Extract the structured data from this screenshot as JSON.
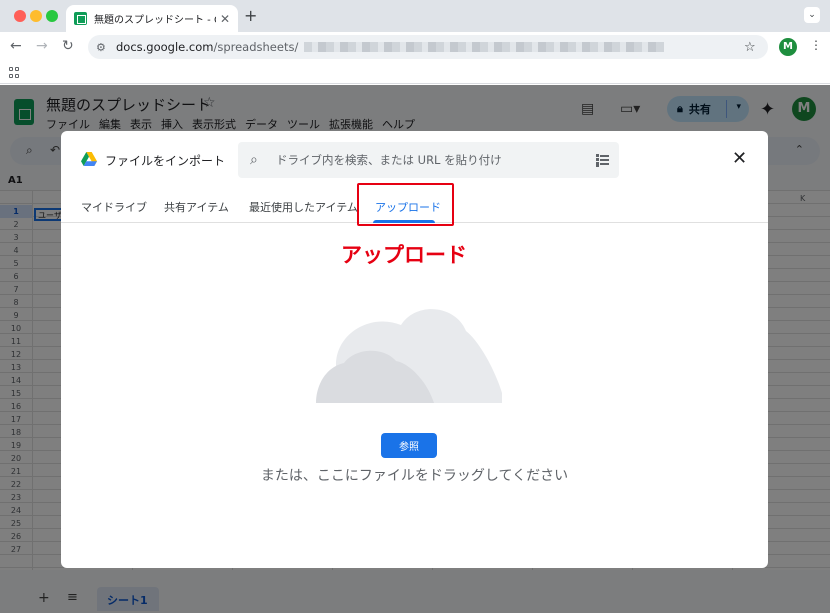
{
  "browser": {
    "tab_title": "無題のスプレッドシート - Google",
    "url_host": "docs.google.com",
    "url_path": "/spreadsheets/",
    "profile_initial": "M"
  },
  "sheets": {
    "doc_title": "無題のスプレッドシート",
    "menu": [
      "ファイル",
      "編集",
      "表示",
      "挿入",
      "表示形式",
      "データ",
      "ツール",
      "拡張機能",
      "ヘルプ"
    ],
    "share_label": "共有",
    "avatar_initial": "M",
    "namebox": "A1",
    "cell_a1": "ユーザ",
    "column_k": "K",
    "row_numbers": [
      "1",
      "2",
      "3",
      "4",
      "5",
      "6",
      "7",
      "8",
      "9",
      "10",
      "11",
      "12",
      "13",
      "14",
      "15",
      "16",
      "17",
      "18",
      "19",
      "20",
      "21",
      "22",
      "23",
      "24",
      "25",
      "26",
      "27"
    ],
    "sheet_tab": "シート1"
  },
  "dialog": {
    "title": "ファイルをインポート",
    "search_placeholder": "ドライブ内を検索、または URL を貼り付け",
    "tabs": [
      {
        "label": "マイドライブ"
      },
      {
        "label": "共有アイテム"
      },
      {
        "label": "最近使用したアイテム"
      },
      {
        "label": "アップロード",
        "active": true
      }
    ],
    "annotation": "アップロード",
    "browse_label": "参照",
    "drop_text": "または、ここにファイルをドラッグしてください"
  },
  "colors": {
    "accent": "#1a73e8",
    "annotation_red": "#e60012",
    "share_bg": "#c2e7ff",
    "avatar_green": "#1e8e3e"
  },
  "icons": [
    "search-icon",
    "filter-icon",
    "close-icon",
    "drive-icon",
    "cloud-illustration",
    "star-icon",
    "gemini-icon",
    "comment-icon",
    "video-icon",
    "lock-icon"
  ]
}
